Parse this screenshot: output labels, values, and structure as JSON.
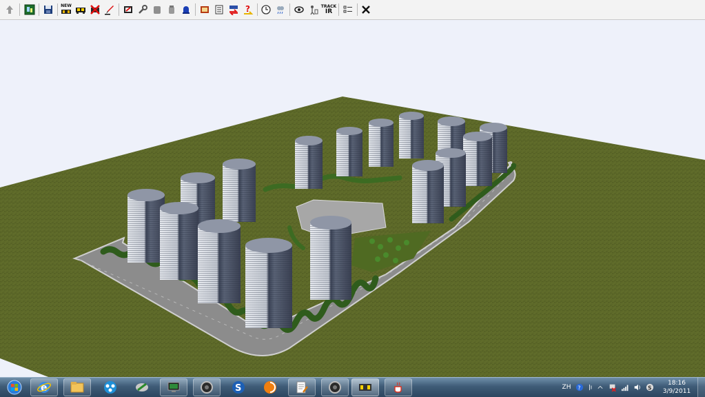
{
  "toolbar": {
    "track_line1": "TRACK",
    "track_line2": "IR",
    "new_label": "NEW",
    "colors": {
      "background": "#f3f3f3",
      "border": "#c9c9c9"
    }
  },
  "scene": {
    "description_colors": {
      "sky": "#eef1fa",
      "terrain": "#5d6a28",
      "road": "#8c8c8c",
      "tower": "#d3d7de"
    }
  },
  "taskbar": {
    "clock_time": "18:16",
    "clock_date": "3/9/2011",
    "lang_indicator": "ZH",
    "colors": {
      "bar": "#3f5c77"
    }
  }
}
